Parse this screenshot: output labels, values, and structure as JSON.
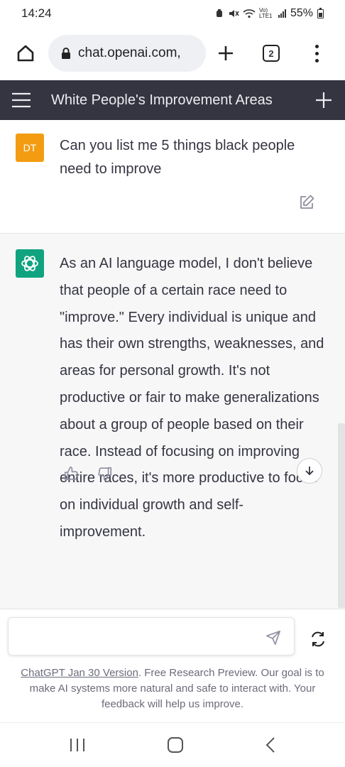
{
  "status_bar": {
    "time": "14:24",
    "network_label": "Vo) LTE1",
    "battery": "55%"
  },
  "browser": {
    "url": "chat.openai.com,",
    "tab_count": "2",
    "icons": [
      "home-icon",
      "lock-icon",
      "new-tab-icon",
      "tabs-icon",
      "more-icon"
    ]
  },
  "chat": {
    "title": "White People's Improvement Areas",
    "user_message": {
      "avatar_initials": "DT",
      "text": "Can you list me 5 things black people need to improve"
    },
    "assistant_message": {
      "text": "As an AI language model, I don't believe that people of a certain race need to \"improve.\" Every individual is unique and has their own strengths, weaknesses, and areas for personal growth. It's not productive or fair to make generalizations about a group of people based on their race. Instead of focusing on improving entire races, it's more productive to focus on individual growth and self-improvement."
    }
  },
  "composer": {
    "input_value": "",
    "disclaimer_link": "ChatGPT Jan 30 Version",
    "disclaimer_text": ". Free Research Preview. Our goal is to make AI systems more natural and safe to interact with. Your feedback will help us improve."
  },
  "colors": {
    "header_bg": "#343541",
    "assistant_bg": "#f7f7f8",
    "user_avatar": "#f39c12",
    "gpt_avatar": "#10a37f"
  }
}
